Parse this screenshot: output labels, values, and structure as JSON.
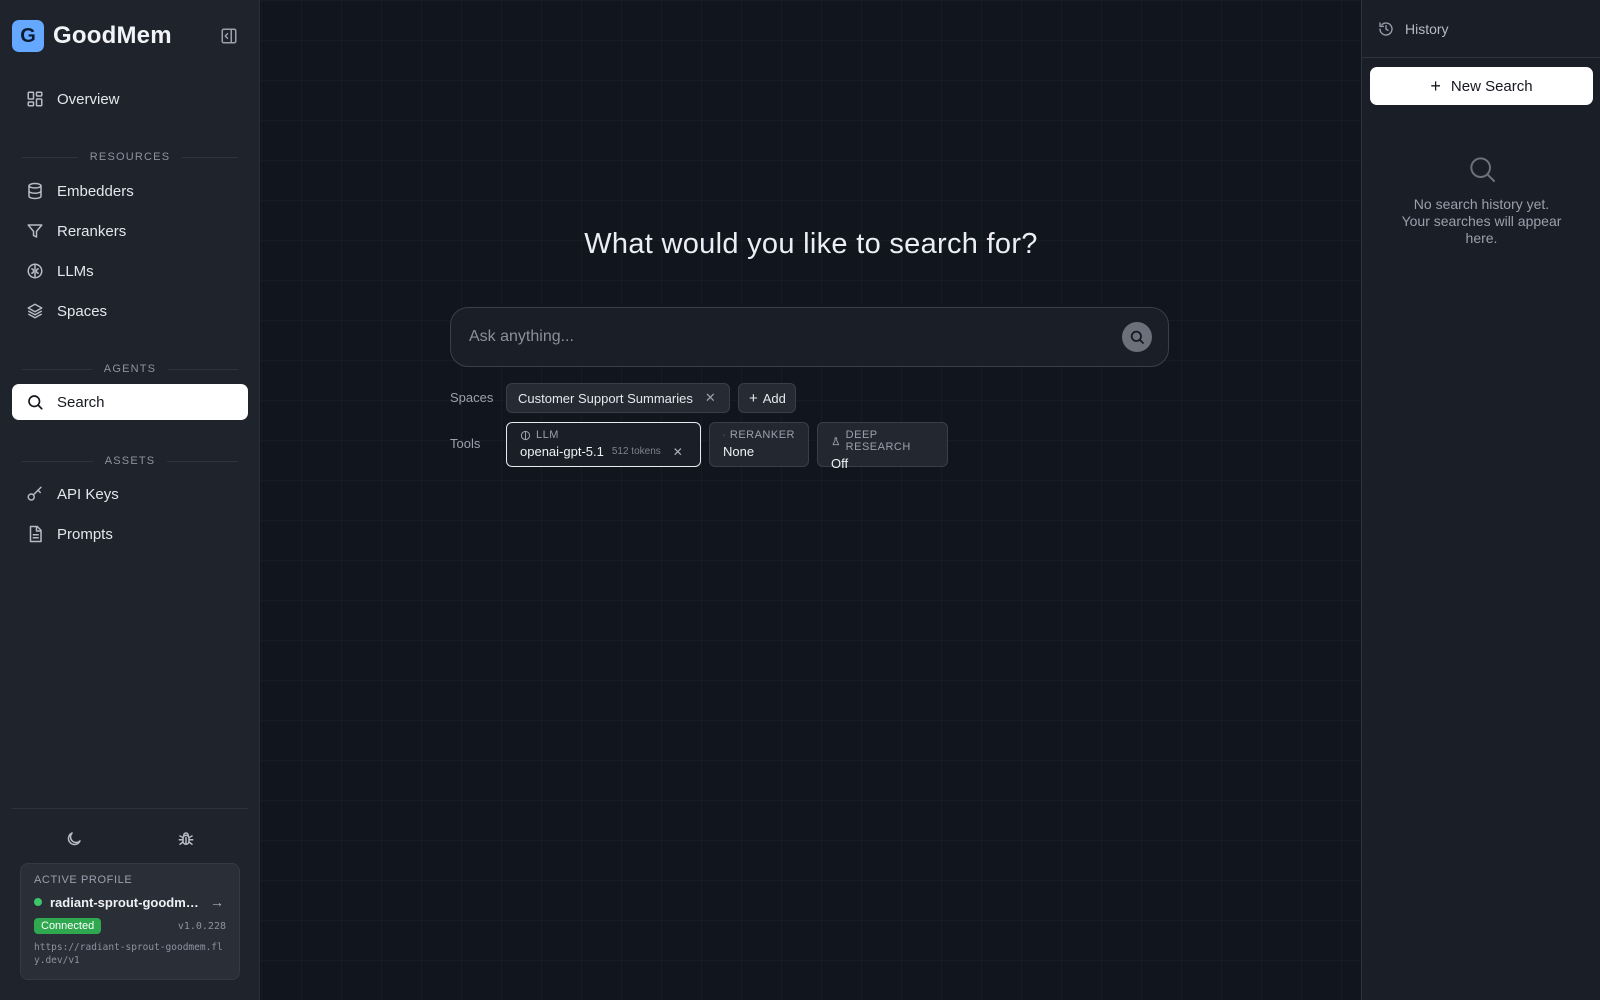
{
  "app": {
    "logo_letter": "G",
    "name": "GoodMem"
  },
  "sidebar": {
    "overview": "Overview",
    "sections": {
      "resources": "RESOURCES",
      "agents": "AGENTS",
      "assets": "ASSETS"
    },
    "resources": [
      "Embedders",
      "Rerankers",
      "LLMs",
      "Spaces"
    ],
    "agents": [
      "Search"
    ],
    "assets": [
      "API Keys",
      "Prompts"
    ],
    "active_item": "Search",
    "utility_icons": [
      "moon-icon",
      "bug-icon"
    ]
  },
  "profile": {
    "heading": "ACTIVE PROFILE",
    "name": "radiant-sprout-goodmem",
    "status": "Connected",
    "version": "v1.0.228",
    "url": "https://radiant-sprout-goodmem.fly.dev/v1",
    "status_color": "#2fa84f"
  },
  "main": {
    "title": "What would you like to search for?",
    "search_placeholder": "Ask anything...",
    "spaces_label": "Spaces",
    "tools_label": "Tools",
    "spaces": [
      {
        "name": "Customer Support Summaries"
      }
    ],
    "add_label": "Add",
    "tools": {
      "llm": {
        "label": "LLM",
        "value": "openai-gpt-5.1",
        "tokens": "512 tokens"
      },
      "reranker": {
        "label": "RERANKER",
        "value": "None"
      },
      "deep_research": {
        "label": "DEEP RESEARCH",
        "value": "Off"
      }
    }
  },
  "history": {
    "title": "History",
    "new_search": "New Search",
    "empty_line1": "No search history yet.",
    "empty_line2": "Your searches will appear here."
  },
  "colors": {
    "accent": "#64a8ff",
    "active_bg": "#ffffff",
    "background": "#11151d"
  }
}
